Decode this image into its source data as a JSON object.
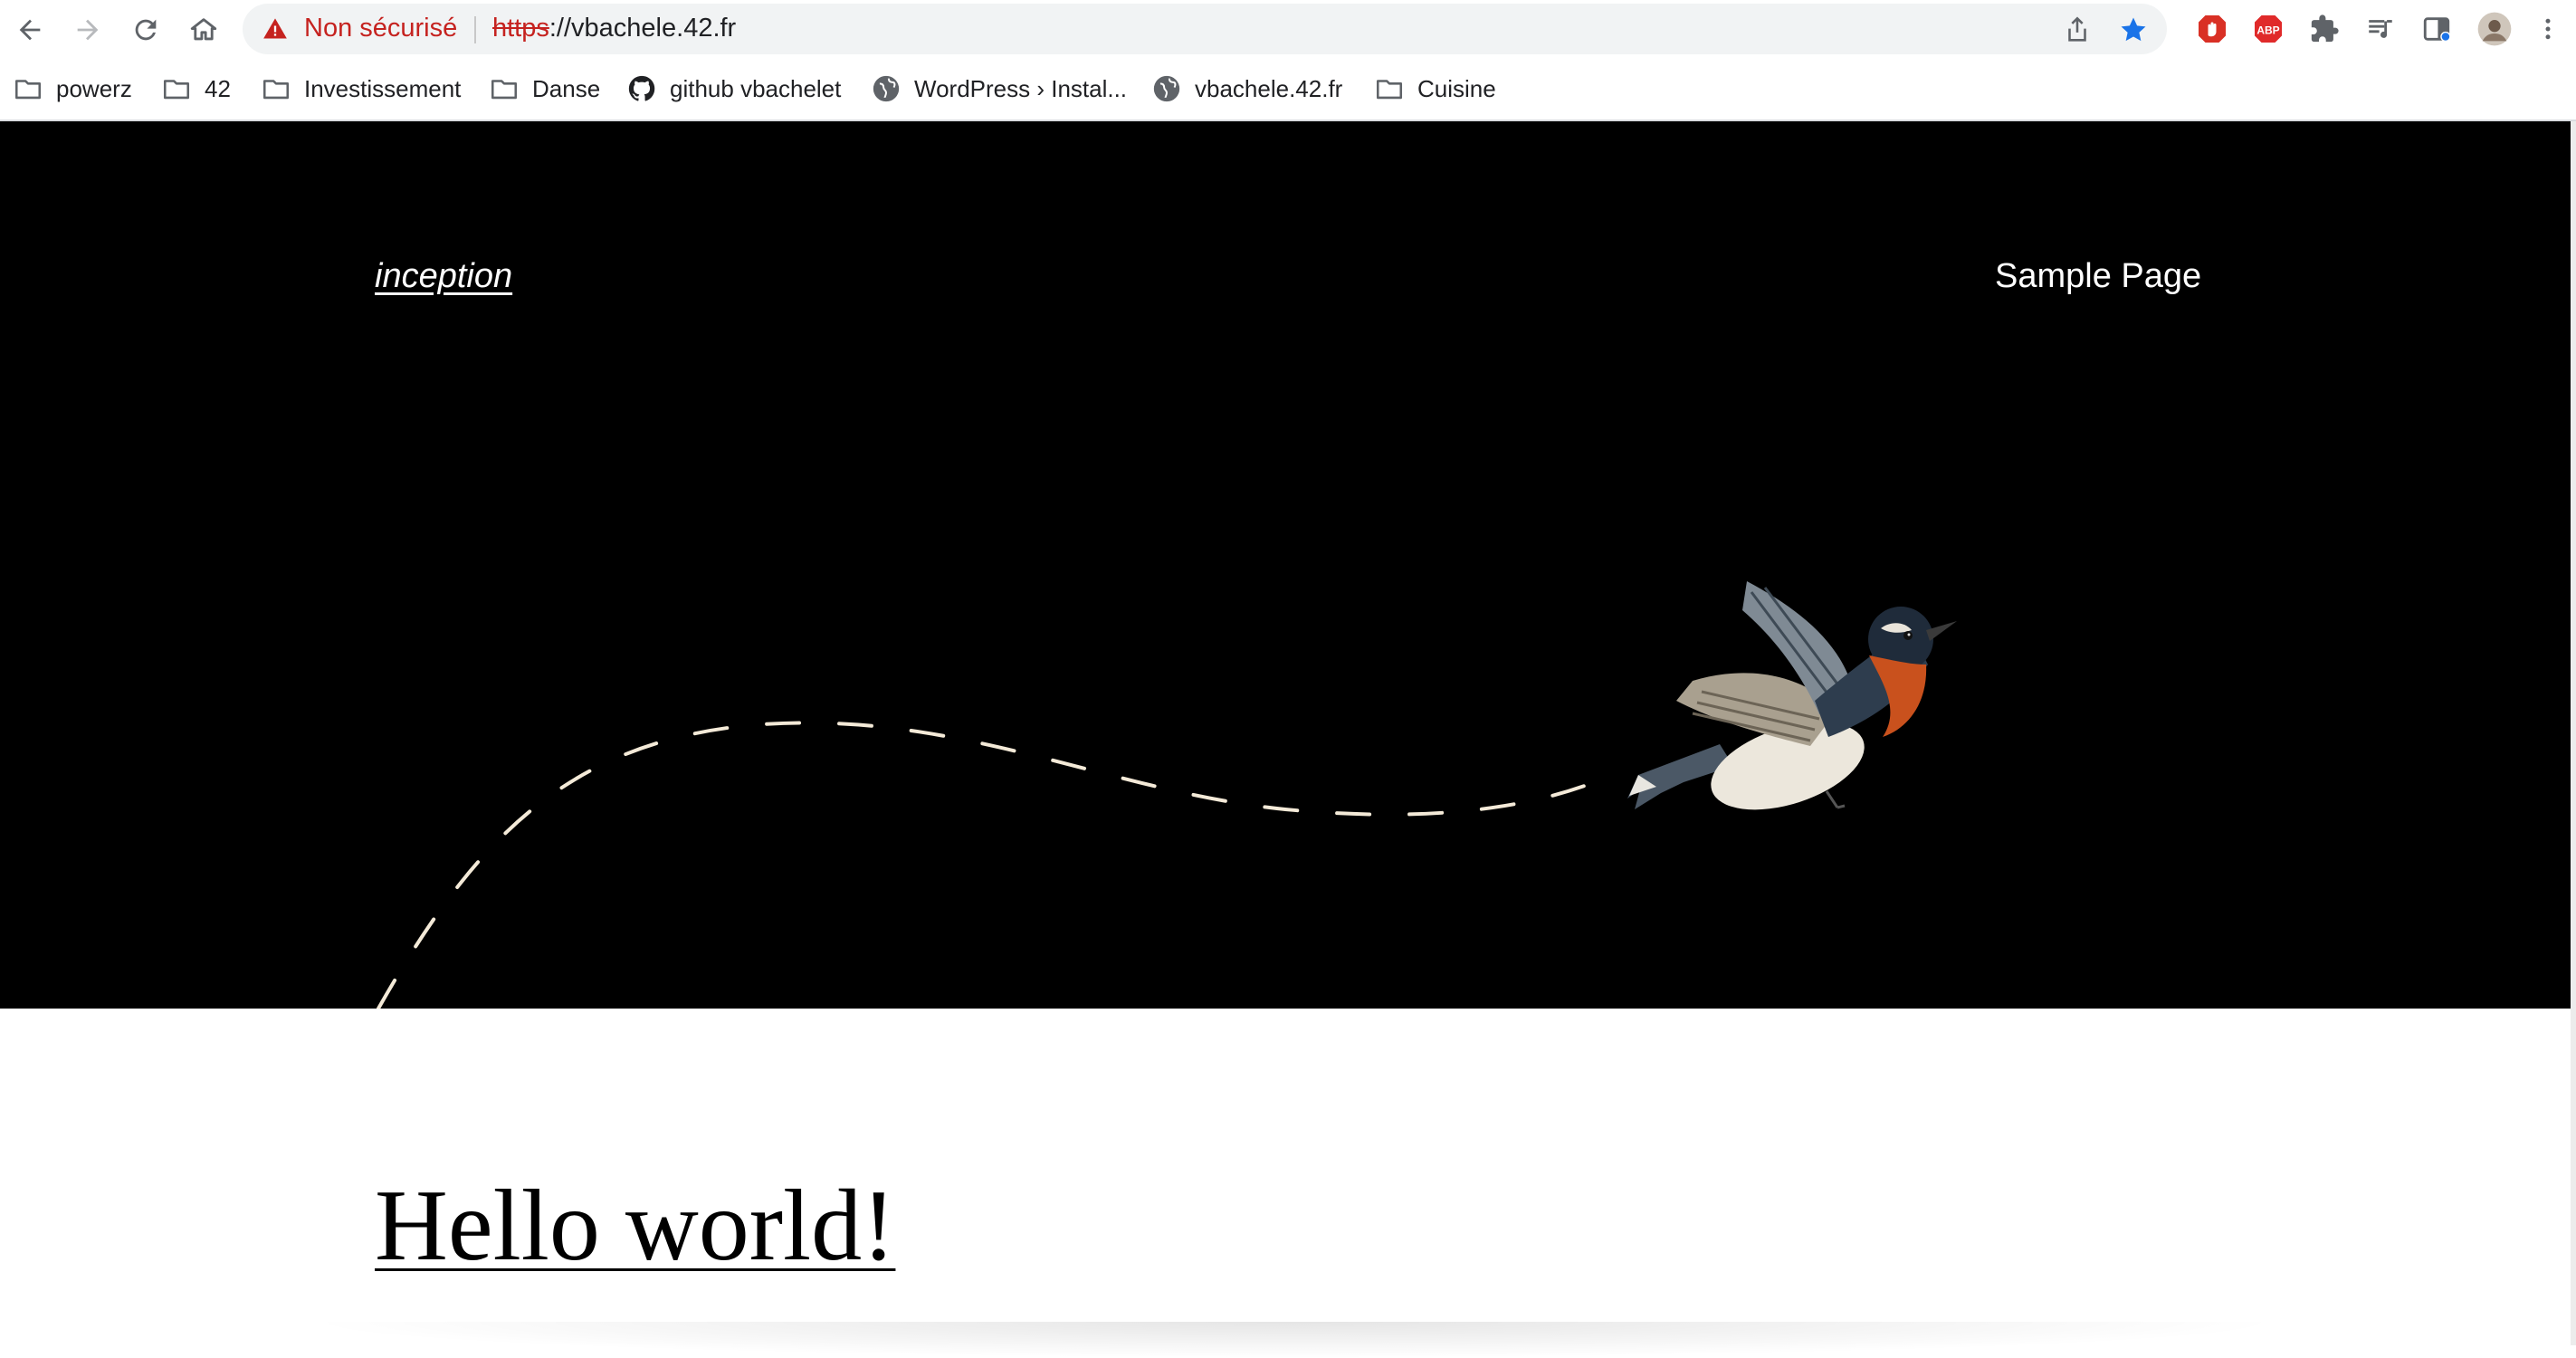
{
  "browser": {
    "security_label": "Non sécurisé",
    "url_scheme": "https",
    "url_rest": "://vbachele.42.fr",
    "bookmarks": [
      {
        "label": "powerz",
        "icon": "folder-icon"
      },
      {
        "label": "42",
        "icon": "folder-icon"
      },
      {
        "label": "Investissement",
        "icon": "folder-icon"
      },
      {
        "label": "Danse",
        "icon": "folder-icon"
      },
      {
        "label": "github vbachelet",
        "icon": "github-icon"
      },
      {
        "label": "WordPress › Instal...",
        "icon": "globe-icon"
      },
      {
        "label": "vbachele.42.fr",
        "icon": "globe-icon"
      },
      {
        "label": "Cuisine",
        "icon": "folder-icon"
      }
    ],
    "extensions": [
      "adblock-hand-icon",
      "abp-icon",
      "puzzle-icon",
      "media-queue-icon",
      "sidebar-icon",
      "profile-avatar-icon",
      "kebab-menu-icon"
    ],
    "abp_label": "ABP",
    "accent_color": "#1a73e8",
    "warning_color": "#c5221f"
  },
  "site": {
    "title": "inception",
    "nav": [
      "Sample Page"
    ],
    "hero_background": "#000000"
  },
  "post": {
    "title": "Hello world!"
  }
}
